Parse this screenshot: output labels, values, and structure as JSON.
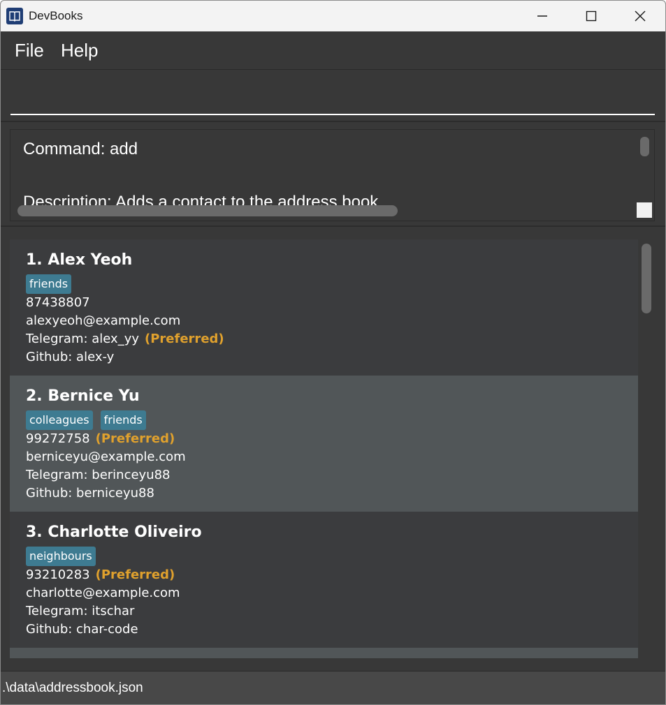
{
  "window": {
    "title": "DevBooks",
    "app_icon": "book-icon"
  },
  "menu": {
    "items": [
      {
        "label": "File"
      },
      {
        "label": "Help"
      }
    ]
  },
  "command": {
    "value": "",
    "placeholder": ""
  },
  "result": {
    "line1": "Command: add",
    "line2": "Description: Adds a contact to the address book."
  },
  "persons": [
    {
      "index_name": "1. Alex Yeoh",
      "tags": [
        "friends"
      ],
      "phone": "87438807",
      "phone_preferred": "",
      "email": "alexyeoh@example.com",
      "telegram": "Telegram: alex_yy",
      "telegram_preferred": "(Preferred)",
      "github": "Github: alex-y"
    },
    {
      "index_name": "2. Bernice Yu",
      "tags": [
        "colleagues",
        "friends"
      ],
      "phone": "99272758",
      "phone_preferred": "(Preferred)",
      "email": "berniceyu@example.com",
      "telegram": "Telegram: berinceyu88",
      "telegram_preferred": "",
      "github": "Github: berniceyu88"
    },
    {
      "index_name": "3. Charlotte Oliveiro",
      "tags": [
        "neighbours"
      ],
      "phone": "93210283",
      "phone_preferred": "(Preferred)",
      "email": "charlotte@example.com",
      "telegram": "Telegram: itschar",
      "telegram_preferred": "",
      "github": "Github: char-code"
    }
  ],
  "status": {
    "path": ".\\data\\addressbook.json"
  },
  "colors": {
    "preferred": "#e0a12d",
    "tag": "#3e7b91",
    "background": "#383838"
  }
}
